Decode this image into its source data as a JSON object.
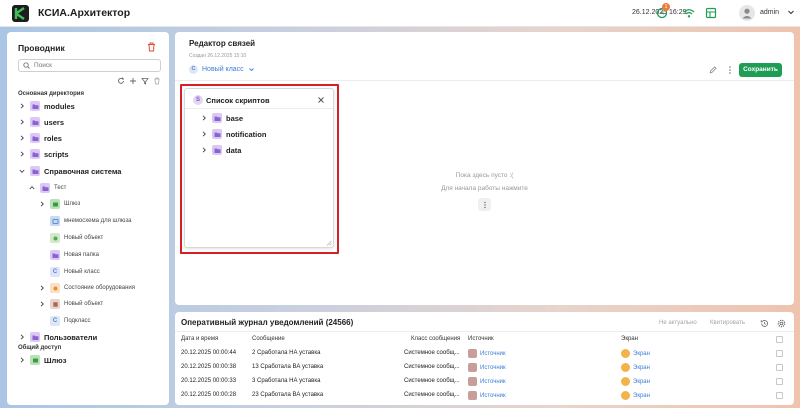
{
  "app": {
    "title": "КСИА.Архитектор",
    "datetime": "26.12.2025 16:29",
    "notification_count": "1",
    "username": "admin"
  },
  "sidebar": {
    "title": "Проводник",
    "search_placeholder": "Поиск",
    "section_main": "Основная директория",
    "section_shared": "Общий доступ",
    "items": [
      "modules",
      "users",
      "roles",
      "scripts",
      "Справочная система",
      "Тест",
      "Шлюз",
      "мнемосхема для шлюза",
      "Новый объект",
      "Новая папка",
      "Новый класс",
      "Состояние оборудования",
      "Новый объект",
      "Подкласс",
      "Пользователи",
      "Шлюз"
    ]
  },
  "editor": {
    "title": "Редактор связей",
    "created": "Создан 26.12.2025 15:10",
    "class_name": "Новый класс",
    "save_label": "Сохранить",
    "empty_line1": "Пока здесь пусто :(",
    "empty_line2": "Для начала работы нажмите"
  },
  "scripts_panel": {
    "title": "Список скриптов",
    "items": [
      "base",
      "notification",
      "data"
    ]
  },
  "journal": {
    "title": "Оперативный журнал уведомлений (24566)",
    "btn_not_actual": "Не актуально",
    "btn_quote": "Квитировать",
    "columns": [
      "Дата и время",
      "Сообщение",
      "Класс сообщения",
      "Источник",
      "Экран"
    ],
    "rows": [
      {
        "date": "20.12.2025 00:00:44",
        "message": "2 Сработала НА уставка",
        "class": "Системное сообщ...",
        "source": "Источник",
        "screen": "Экран"
      },
      {
        "date": "20.12.2025 00:00:38",
        "message": "13 Сработала ВА уставка",
        "class": "Системное сообщ...",
        "source": "Источник",
        "screen": "Экран"
      },
      {
        "date": "20.12.2025 00:00:33",
        "message": "3 Сработала НА уставка",
        "class": "Системное сообщ...",
        "source": "Источник",
        "screen": "Экран"
      },
      {
        "date": "20.12.2025 00:00:28",
        "message": "23 Сработала ВА уставка",
        "class": "Системное сообщ...",
        "source": "Источник",
        "screen": "Экран"
      }
    ]
  },
  "colors": {
    "accent": "#1f9d55",
    "link": "#3b7ed6",
    "highlight": "#d51f27"
  }
}
